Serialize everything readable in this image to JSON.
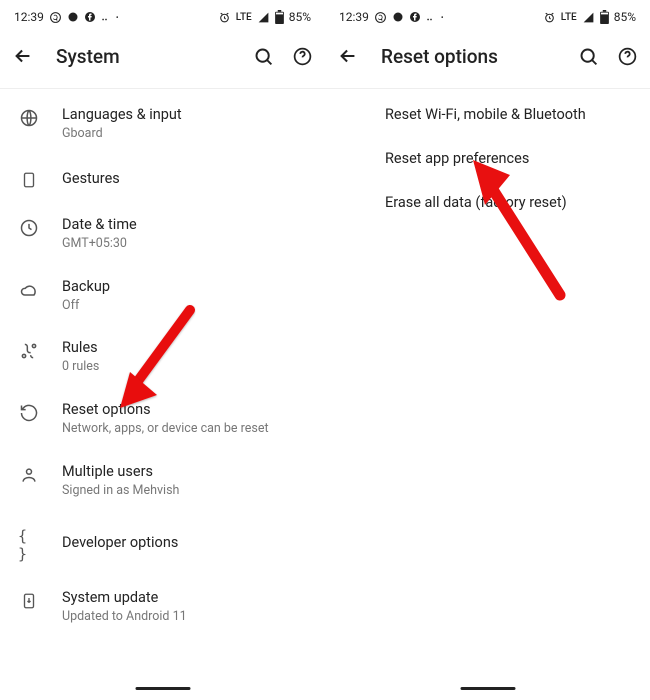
{
  "status": {
    "time": "12:39",
    "lte": "LTE",
    "battery": "85%"
  },
  "left": {
    "title": "System",
    "items": [
      {
        "label": "Languages & input",
        "sub": "Gboard"
      },
      {
        "label": "Gestures",
        "sub": ""
      },
      {
        "label": "Date & time",
        "sub": "GMT+05:30"
      },
      {
        "label": "Backup",
        "sub": "Off"
      },
      {
        "label": "Rules",
        "sub": "0 rules"
      },
      {
        "label": "Reset options",
        "sub": "Network, apps, or device can be reset"
      },
      {
        "label": "Multiple users",
        "sub": "Signed in as Mehvish"
      },
      {
        "label": "Developer options",
        "sub": ""
      },
      {
        "label": "System update",
        "sub": "Updated to Android 11"
      }
    ]
  },
  "right": {
    "title": "Reset options",
    "items": [
      {
        "label": "Reset Wi-Fi, mobile & Bluetooth"
      },
      {
        "label": "Reset app preferences"
      },
      {
        "label": "Erase all data (factory reset)"
      }
    ]
  }
}
